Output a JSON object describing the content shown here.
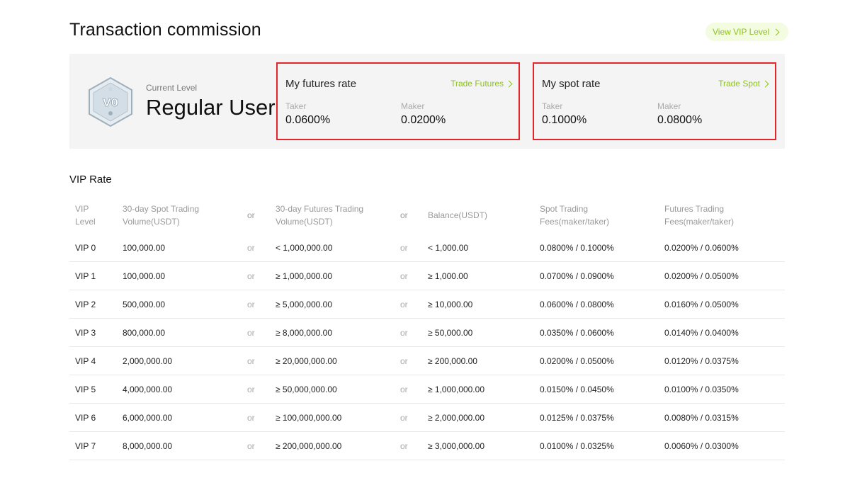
{
  "page": {
    "title": "Transaction commission",
    "view_vip_label": "View VIP Level"
  },
  "level": {
    "badge_text": "V0",
    "current_label": "Current Level",
    "current_value": "Regular User"
  },
  "futures_rate": {
    "title": "My futures rate",
    "link": "Trade Futures",
    "taker_label": "Taker",
    "taker_value": "0.0600%",
    "maker_label": "Maker",
    "maker_value": "0.0200%"
  },
  "spot_rate": {
    "title": "My spot rate",
    "link": "Trade Spot",
    "taker_label": "Taker",
    "taker_value": "0.1000%",
    "maker_label": "Maker",
    "maker_value": "0.0800%"
  },
  "vip_table": {
    "section_title": "VIP Rate",
    "headers": {
      "level_1": "VIP",
      "level_2": "Level",
      "spot_vol_1": "30-day Spot Trading",
      "spot_vol_2": "Volume(USDT)",
      "or": "or",
      "fut_vol_1": "30-day Futures Trading",
      "fut_vol_2": "Volume(USDT)",
      "balance": "Balance(USDT)",
      "spot_fee_1": "Spot Trading",
      "spot_fee_2": "Fees(maker/taker)",
      "fut_fee_1": "Futures Trading",
      "fut_fee_2": "Fees(maker/taker)"
    },
    "or_text": "or",
    "rows": [
      {
        "level": "VIP 0",
        "spot_vol": "100,000.00",
        "fut_vol": "< 1,000,000.00",
        "balance": "< 1,000.00",
        "spot_fee": "0.0800% / 0.1000%",
        "fut_fee": "0.0200% / 0.0600%"
      },
      {
        "level": "VIP 1",
        "spot_vol": "100,000.00",
        "fut_vol": "≥ 1,000,000.00",
        "balance": "≥ 1,000.00",
        "spot_fee": "0.0700% / 0.0900%",
        "fut_fee": "0.0200% / 0.0500%"
      },
      {
        "level": "VIP 2",
        "spot_vol": "500,000.00",
        "fut_vol": "≥ 5,000,000.00",
        "balance": "≥ 10,000.00",
        "spot_fee": "0.0600% / 0.0800%",
        "fut_fee": "0.0160% / 0.0500%"
      },
      {
        "level": "VIP 3",
        "spot_vol": "800,000.00",
        "fut_vol": "≥ 8,000,000.00",
        "balance": "≥ 50,000.00",
        "spot_fee": "0.0350% / 0.0600%",
        "fut_fee": "0.0140% / 0.0400%"
      },
      {
        "level": "VIP 4",
        "spot_vol": "2,000,000.00",
        "fut_vol": "≥ 20,000,000.00",
        "balance": "≥ 200,000.00",
        "spot_fee": "0.0200% / 0.0500%",
        "fut_fee": "0.0120% / 0.0375%"
      },
      {
        "level": "VIP 5",
        "spot_vol": "4,000,000.00",
        "fut_vol": "≥ 50,000,000.00",
        "balance": "≥ 1,000,000.00",
        "spot_fee": "0.0150% / 0.0450%",
        "fut_fee": "0.0100% / 0.0350%"
      },
      {
        "level": "VIP 6",
        "spot_vol": "6,000,000.00",
        "fut_vol": "≥ 100,000,000.00",
        "balance": "≥ 2,000,000.00",
        "spot_fee": "0.0125% / 0.0375%",
        "fut_fee": "0.0080% / 0.0315%"
      },
      {
        "level": "VIP 7",
        "spot_vol": "8,000,000.00",
        "fut_vol": "≥ 200,000,000.00",
        "balance": "≥ 3,000,000.00",
        "spot_fee": "0.0100% / 0.0325%",
        "fut_fee": "0.0060% / 0.0300%"
      }
    ]
  },
  "colors": {
    "accent": "#8ec21f",
    "highlight_border": "#e3242b",
    "panel_bg": "#f4f4f4"
  }
}
